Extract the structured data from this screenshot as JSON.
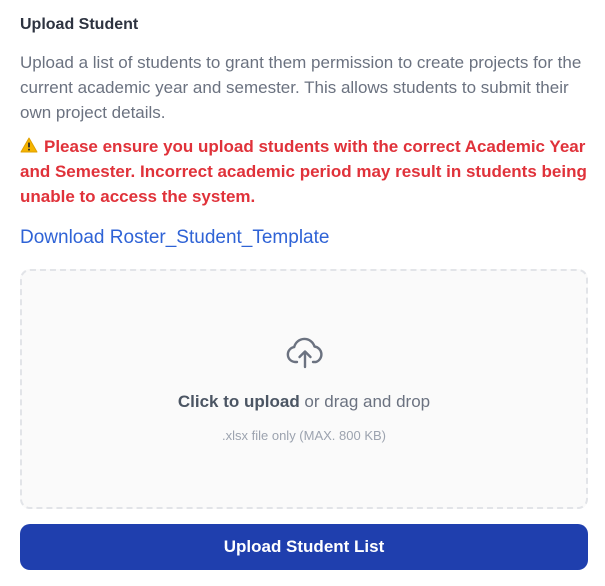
{
  "section": {
    "heading": "Upload Student",
    "description": "Upload a list of students to grant them permission to create projects for the current academic year and semester. This allows students to submit their own project details.",
    "warning_icon": "warning-triangle-icon",
    "warning_text": "Please ensure you upload students with the correct Academic Year and Semester. Incorrect academic period may result in students being unable to access the system."
  },
  "download": {
    "label": "Download Roster_Student_Template"
  },
  "dropzone": {
    "icon": "cloud-upload-icon",
    "click_label": "Click to upload",
    "drag_label": " or drag and drop",
    "hint": ".xlsx file only (MAX. 800 KB)"
  },
  "submit": {
    "label": "Upload Student List"
  },
  "colors": {
    "accent_button": "#1f3fae",
    "link": "#2f63d6",
    "warning": "#e0323a"
  }
}
